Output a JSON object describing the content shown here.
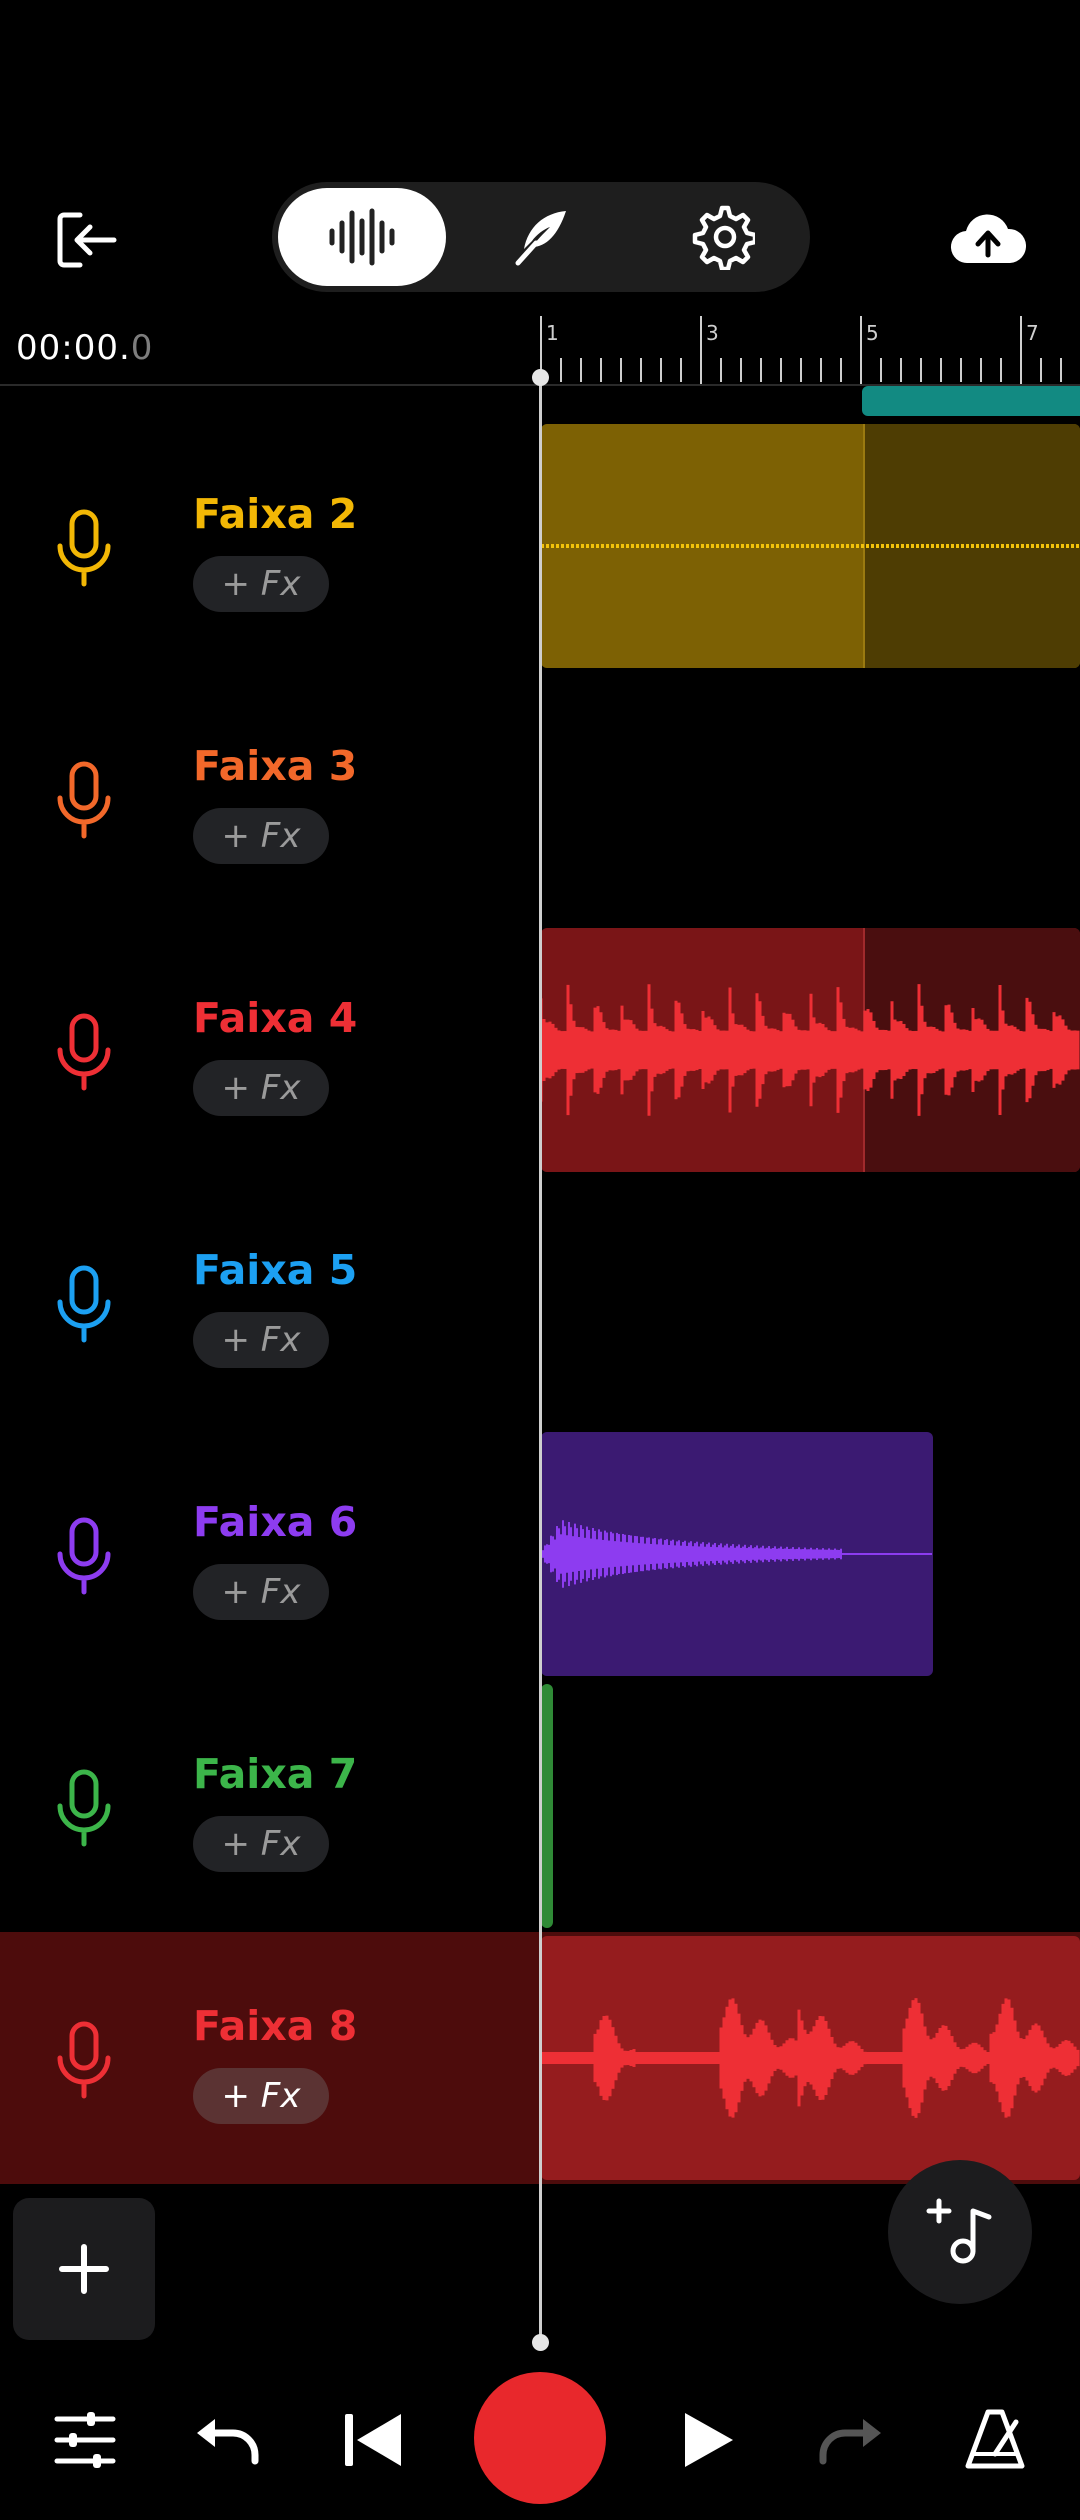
{
  "timer": {
    "main": "00:00.",
    "fraction": "0"
  },
  "ruler": {
    "bars": [
      "1",
      "3",
      "5",
      "7"
    ]
  },
  "tracks": [
    {
      "name": "Faixa 2",
      "fx_label": "+ Fx",
      "color": "#f2b705"
    },
    {
      "name": "Faixa 3",
      "fx_label": "+ Fx",
      "color": "#f2682a"
    },
    {
      "name": "Faixa 4",
      "fx_label": "+ Fx",
      "color": "#ee2f35"
    },
    {
      "name": "Faixa 5",
      "fx_label": "+ Fx",
      "color": "#1ca0f2"
    },
    {
      "name": "Faixa 6",
      "fx_label": "+ Fx",
      "color": "#8d3cf0"
    },
    {
      "name": "Faixa 7",
      "fx_label": "+ Fx",
      "color": "#3cb54a"
    },
    {
      "name": "Faixa 8",
      "fx_label": "+ Fx",
      "color": "#ee2f35"
    }
  ],
  "colors": {
    "background": "#000000",
    "record": "#e8282c",
    "loop_region": "#128a82",
    "selected_track_bg": "#4d0c0c"
  },
  "icons": {
    "exit": "exit-icon",
    "mode_waveform": "waveform-icon",
    "mode_quill": "quill-icon",
    "mode_settings": "gear-icon",
    "cloud": "cloud-upload-icon",
    "add_track": "plus-icon",
    "add_instrument": "add-music-note-icon",
    "mixer": "sliders-icon",
    "undo": "undo-icon",
    "skip_back": "skip-back-icon",
    "record": "record-icon",
    "play": "play-icon",
    "redo": "redo-icon",
    "metronome": "metronome-icon"
  }
}
